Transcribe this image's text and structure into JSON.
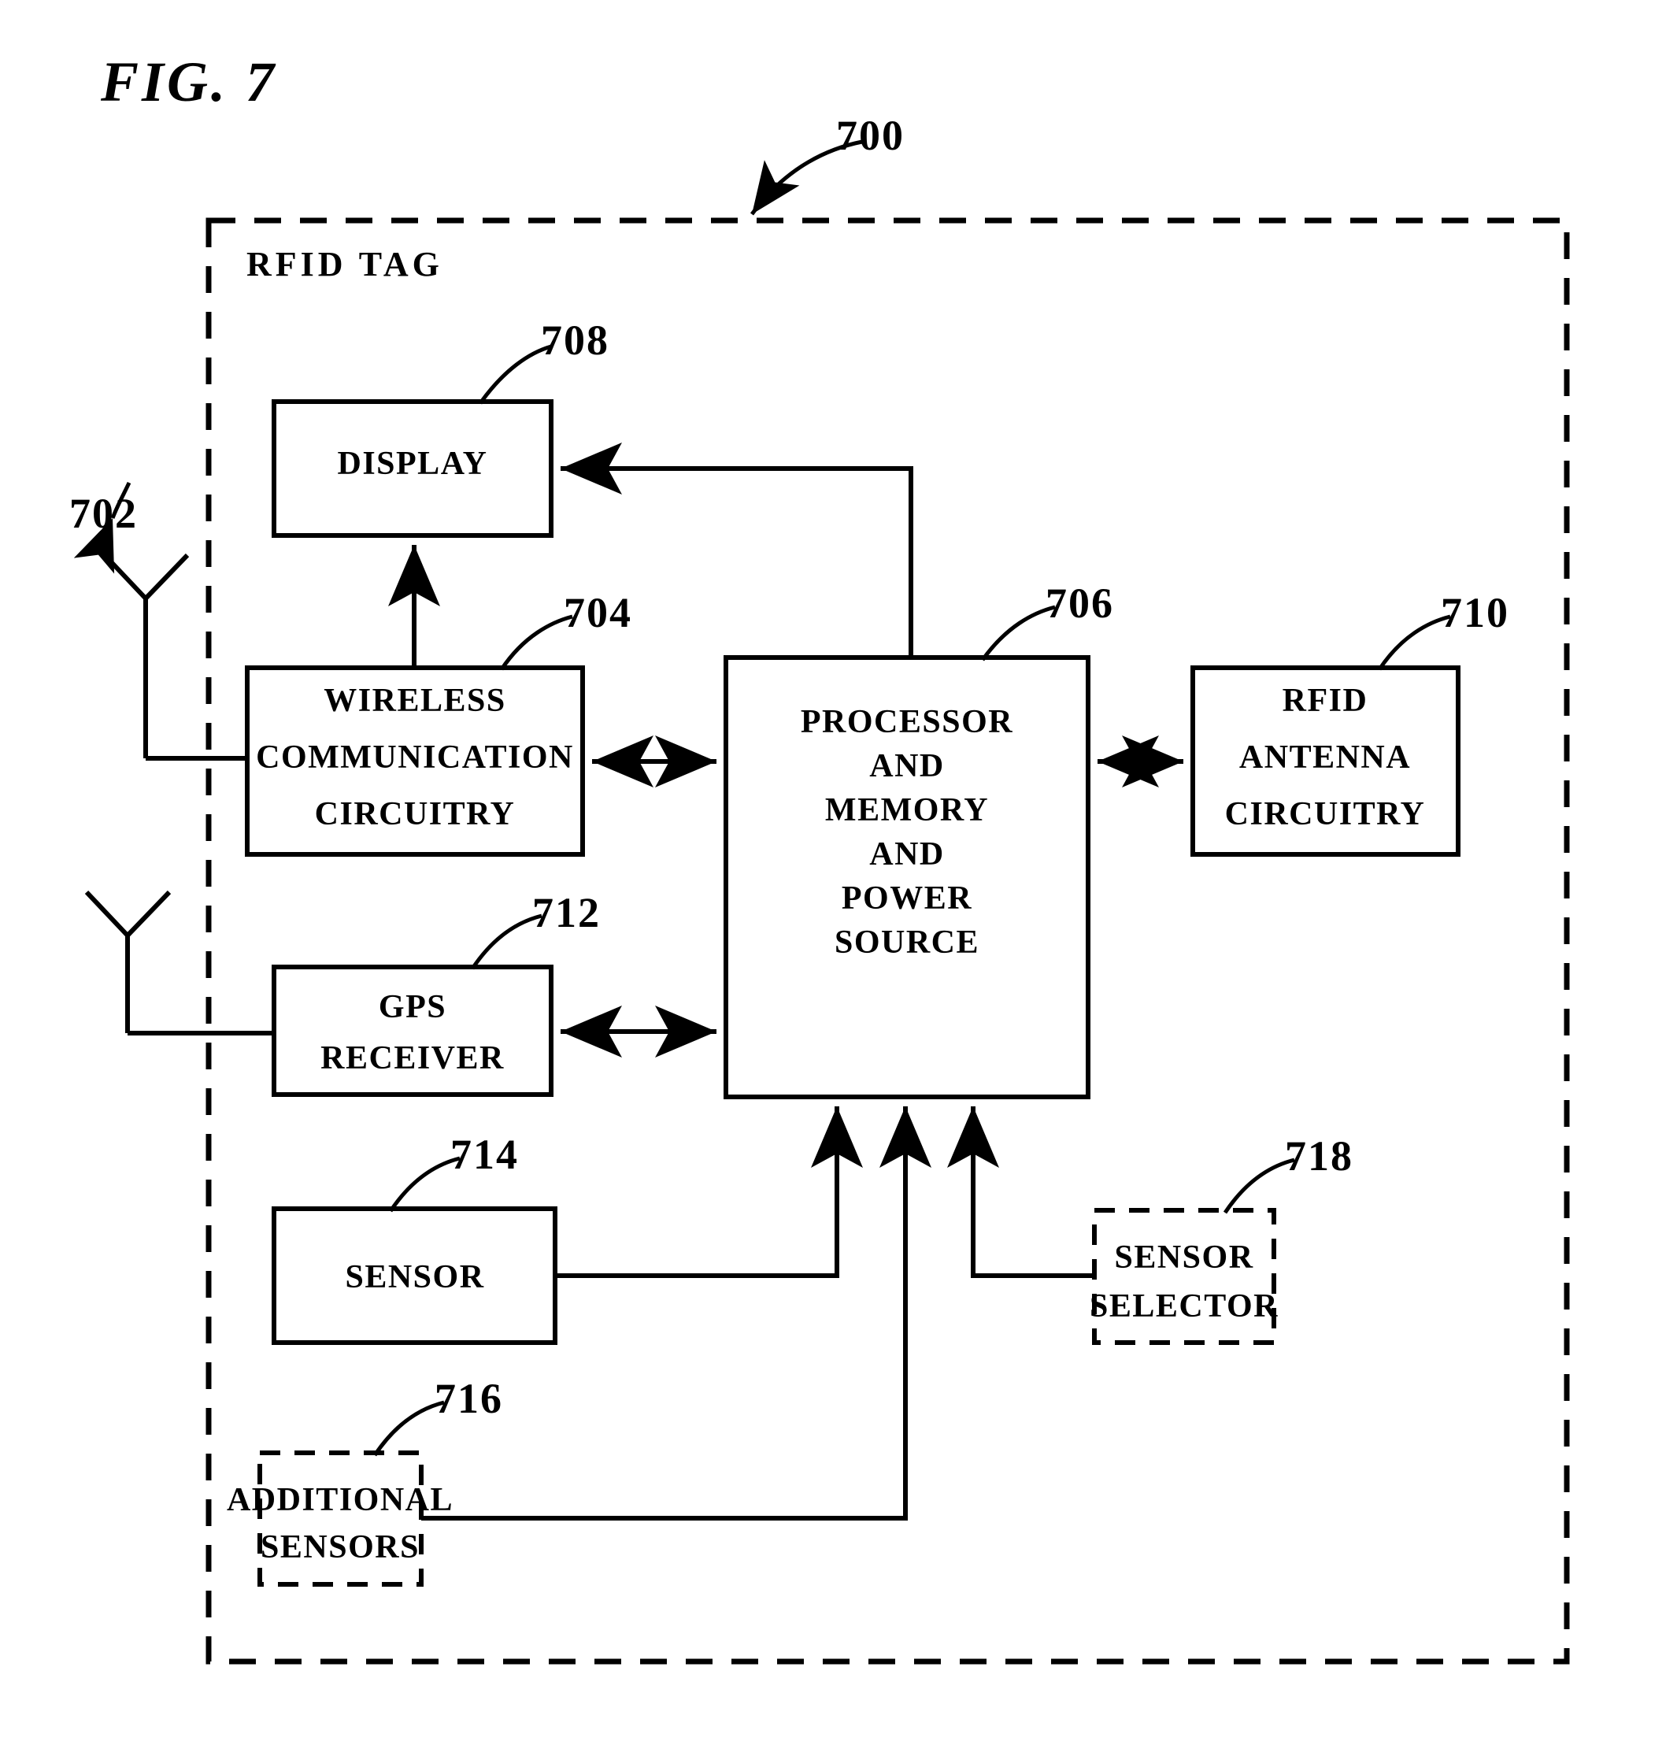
{
  "figure": {
    "title": "FIG. 7",
    "container_label": "RFID TAG",
    "container_ref": "700"
  },
  "refs": {
    "antenna_wireless": "702",
    "wireless": "704",
    "processor": "706",
    "display": "708",
    "rfid_antenna": "710",
    "gps": "712",
    "sensor": "714",
    "additional_sensors": "716",
    "sensor_selector": "718"
  },
  "blocks": {
    "display": {
      "label": "DISPLAY",
      "lines": [
        "DISPLAY"
      ],
      "style": "solid"
    },
    "wireless": {
      "label": "WIRELESS COMMUNICATION CIRCUITRY",
      "lines": [
        "WIRELESS",
        "COMMUNICATION",
        "CIRCUITRY"
      ],
      "style": "solid"
    },
    "processor": {
      "label": "PROCESSOR AND MEMORY AND POWER SOURCE",
      "lines": [
        "PROCESSOR",
        "AND",
        "MEMORY",
        "AND",
        "POWER",
        "SOURCE"
      ],
      "style": "solid"
    },
    "rfid_antenna": {
      "label": "RFID ANTENNA CIRCUITRY",
      "lines": [
        "RFID",
        "ANTENNA",
        "CIRCUITRY"
      ],
      "style": "solid"
    },
    "gps": {
      "label": "GPS RECEIVER",
      "lines": [
        "GPS",
        "RECEIVER"
      ],
      "style": "solid"
    },
    "sensor": {
      "label": "SENSOR",
      "lines": [
        "SENSOR"
      ],
      "style": "solid"
    },
    "additional_sensors": {
      "label": "ADDITIONAL SENSORS",
      "lines": [
        "ADDITIONAL",
        "SENSORS"
      ],
      "style": "dashed"
    },
    "sensor_selector": {
      "label": "SENSOR SELECTOR",
      "lines": [
        "SENSOR",
        "SELECTOR"
      ],
      "style": "dashed"
    }
  },
  "colors": {
    "ink": "#000000",
    "paper": "#ffffff"
  }
}
